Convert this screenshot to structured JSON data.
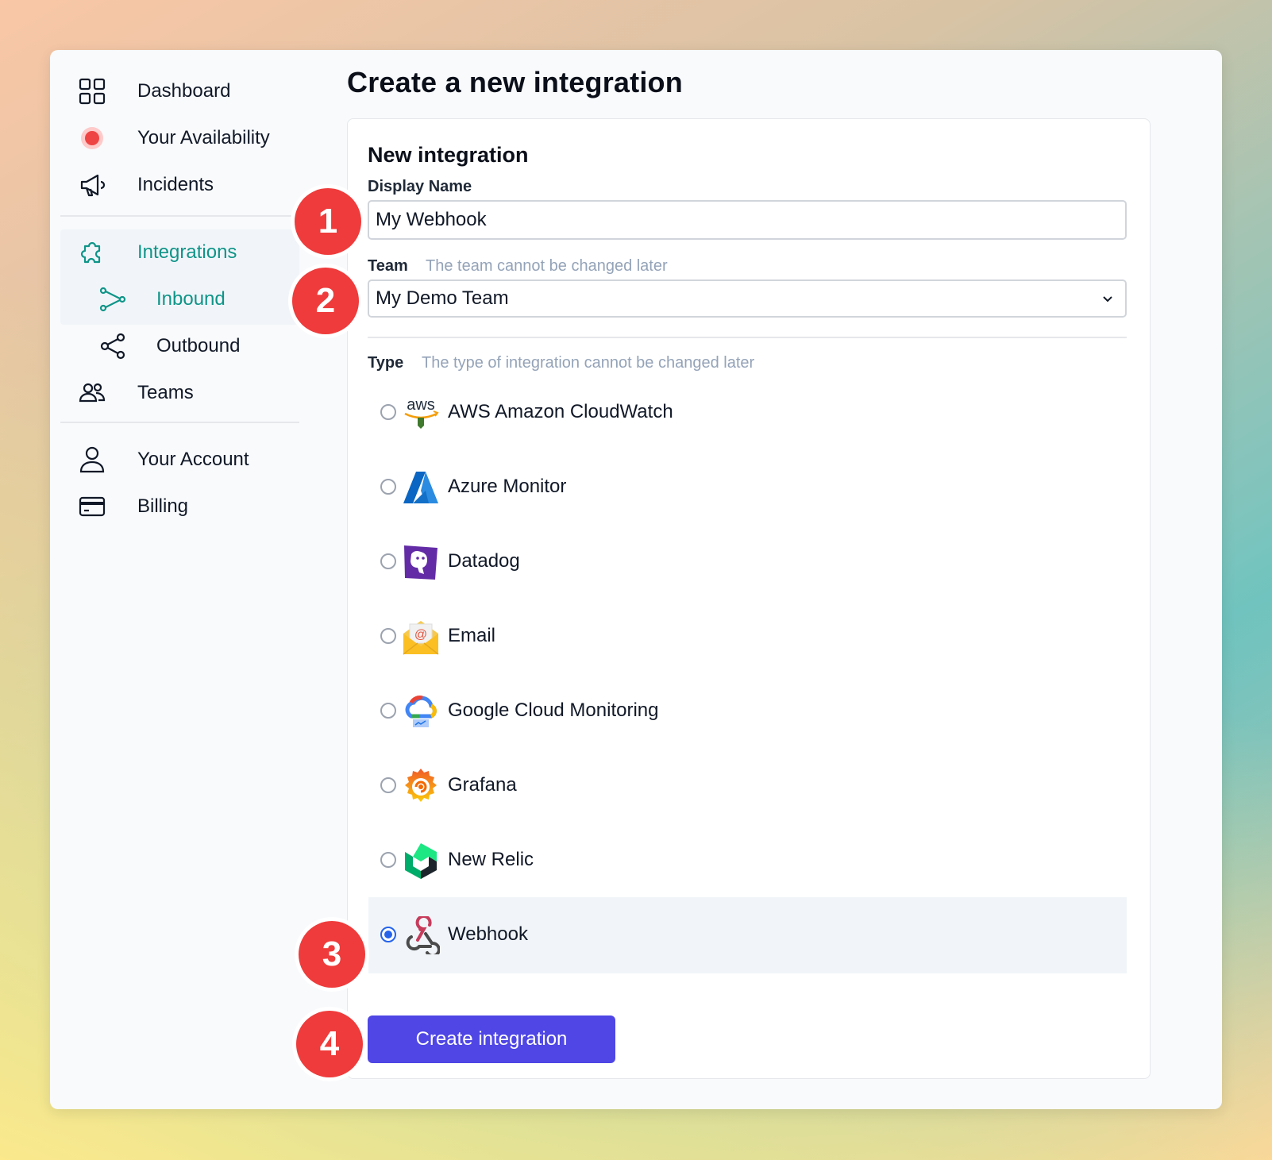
{
  "sidebar": {
    "items": [
      {
        "label": "Dashboard",
        "icon": "grid-icon"
      },
      {
        "label": "Your Availability",
        "icon": "status-dot-icon"
      },
      {
        "label": "Incidents",
        "icon": "megaphone-icon"
      },
      {
        "label": "Integrations",
        "icon": "puzzle-icon"
      },
      {
        "label": "Inbound",
        "icon": "inbound-icon"
      },
      {
        "label": "Outbound",
        "icon": "share-icon"
      },
      {
        "label": "Teams",
        "icon": "users-icon"
      },
      {
        "label": "Your Account",
        "icon": "user-icon"
      },
      {
        "label": "Billing",
        "icon": "card-icon"
      }
    ]
  },
  "page": {
    "title": "Create a new integration"
  },
  "form": {
    "title": "New integration",
    "display_name": {
      "label": "Display Name",
      "value": "My Webhook"
    },
    "team": {
      "label": "Team",
      "hint": "The team cannot be changed later",
      "value": "My Demo Team"
    },
    "type": {
      "label": "Type",
      "hint": "The type of integration cannot be changed later",
      "options": [
        {
          "name": "AWS Amazon CloudWatch",
          "icon": "aws-logo-icon",
          "checked": false
        },
        {
          "name": "Azure Monitor",
          "icon": "azure-logo-icon",
          "checked": false
        },
        {
          "name": "Datadog",
          "icon": "datadog-logo-icon",
          "checked": false
        },
        {
          "name": "Email",
          "icon": "email-logo-icon",
          "checked": false
        },
        {
          "name": "Google Cloud Monitoring",
          "icon": "google-cloud-logo-icon",
          "checked": false
        },
        {
          "name": "Grafana",
          "icon": "grafana-logo-icon",
          "checked": false
        },
        {
          "name": "New Relic",
          "icon": "newrelic-logo-icon",
          "checked": false
        },
        {
          "name": "Webhook",
          "icon": "webhook-logo-icon",
          "checked": true
        }
      ]
    },
    "submit_label": "Create integration"
  },
  "badges": [
    "1",
    "2",
    "3",
    "4"
  ],
  "colors": {
    "accent": "#4f46e5",
    "active_nav": "#0f9488",
    "badge": "#ef3b3b",
    "radio_checked": "#2563eb"
  }
}
